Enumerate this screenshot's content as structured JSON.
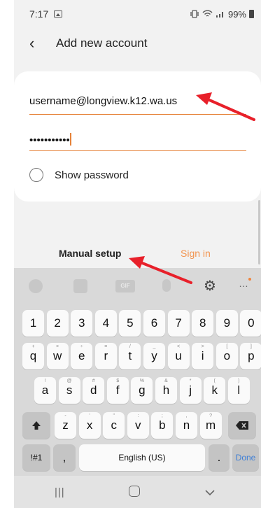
{
  "status": {
    "time": "7:17",
    "battery": "99%"
  },
  "header": {
    "title": "Add new account"
  },
  "form": {
    "email_value": "username@longview.k12.wa.us",
    "password_masked": "•••••••••••",
    "show_password_label": "Show password"
  },
  "actions": {
    "manual_setup_label": "Manual setup",
    "sign_in_label": "Sign in"
  },
  "keyboard": {
    "toolbar": {
      "gif_label": "GIF"
    },
    "number_row": [
      "1",
      "2",
      "3",
      "4",
      "5",
      "6",
      "7",
      "8",
      "9",
      "0"
    ],
    "row1": [
      "q",
      "w",
      "e",
      "r",
      "t",
      "y",
      "u",
      "i",
      "o",
      "p"
    ],
    "row1_hints": [
      "+",
      "×",
      "÷",
      "=",
      "/",
      "_",
      "<",
      ">",
      "[",
      "]"
    ],
    "row2": [
      "a",
      "s",
      "d",
      "f",
      "g",
      "h",
      "j",
      "k",
      "l"
    ],
    "row2_hints": [
      "!",
      "@",
      "#",
      "$",
      "%",
      "&",
      "*",
      "(",
      ")"
    ],
    "row3": [
      "z",
      "x",
      "c",
      "v",
      "b",
      "n",
      "m"
    ],
    "row3_hints": [
      "-",
      "'",
      "\"",
      ":",
      ";",
      ",",
      "?"
    ],
    "symbols_label": "!#1",
    "comma_label": ",",
    "space_label": "English (US)",
    "period_label": ".",
    "done_label": "Done"
  },
  "colors": {
    "accent": "#e6833a",
    "sign_in": "#f2944f",
    "annotation_arrow": "#e8202a",
    "done_key_text": "#3f7fd6"
  }
}
